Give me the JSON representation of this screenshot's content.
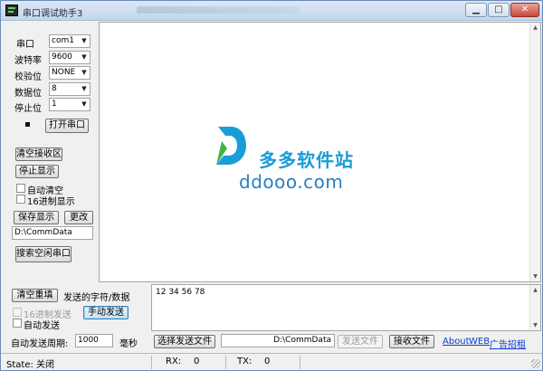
{
  "window": {
    "title": "串口调试助手3"
  },
  "port_settings": {
    "port_label": "串口",
    "port_value": "com1",
    "baud_label": "波特率",
    "baud_value": "9600",
    "parity_label": "校验位",
    "parity_value": "NONE",
    "databits_label": "数据位",
    "databits_value": "8",
    "stopbits_label": "停止位",
    "stopbits_value": "1",
    "open_port_button": "打开串口"
  },
  "receive_controls": {
    "clear_receive_button": "清空接收区",
    "stop_display_button": "停止显示",
    "auto_clear_label": "自动清空",
    "hex_display_label": "16进制显示",
    "save_display_button": "保存显示",
    "change_button": "更改",
    "save_path": "D:\\CommData",
    "search_ports_button": "搜索空闲串口"
  },
  "receive_area": {
    "watermark_cn": "多多软件站",
    "watermark_en": "ddooo.com"
  },
  "send_controls": {
    "clear_resend_button": "清空重填",
    "send_label": "发送的字符/数据",
    "hex_send_label": "16进制发送",
    "auto_send_label": "自动发送",
    "manual_send_button": "手动发送",
    "auto_period_label": "自动发送周期:",
    "period_value": "1000",
    "period_unit": "毫秒",
    "send_text": "12 34 56 78"
  },
  "file_controls": {
    "select_file_button": "选择发送文件",
    "file_path": "D:\\CommData",
    "send_file_button": "发送文件",
    "receive_file_button": "接收文件",
    "links": [
      "About",
      "WEB",
      "广告招租"
    ]
  },
  "status_bar": {
    "state_text": "State: 关闭",
    "rx_label": "RX:",
    "rx_value": "0",
    "tx_label": "TX:",
    "tx_value": "0"
  },
  "colors": {
    "link": "#0b3fd6",
    "watermark": "#1a9cd8",
    "close_button": "#c9463a"
  }
}
